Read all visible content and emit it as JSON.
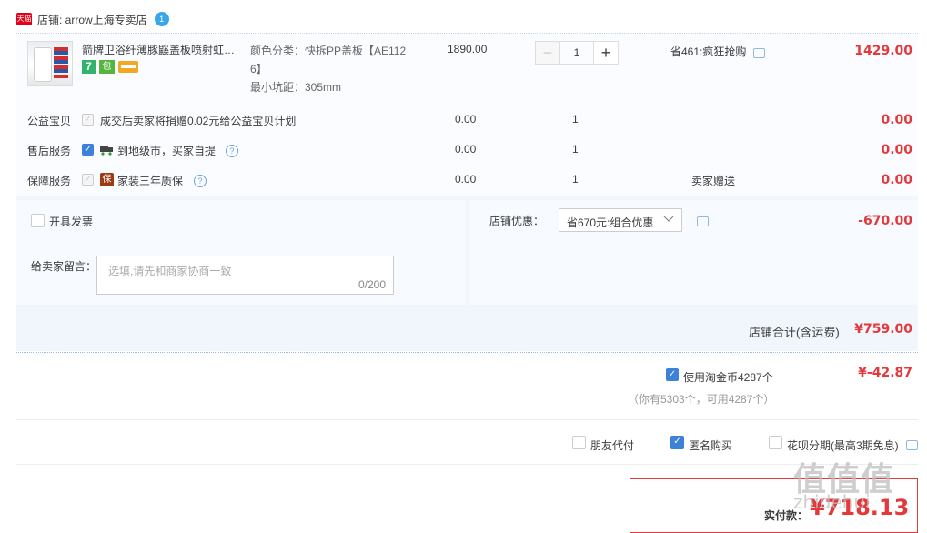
{
  "shop": {
    "label": "店铺: arrow上海专卖店",
    "badge": "天猫",
    "chat_badge": "1"
  },
  "item": {
    "title": "箭牌卫浴纤薄豚鼷盖板喷射虹吸马桶",
    "badge_seven": "7",
    "badge_green": "包",
    "sku_line1": "颜色分类：快拆PP盖板【AE112",
    "sku_line2": "6】",
    "sku_line3": "最小坑距：305mm",
    "price": "1890.00",
    "qty": "1",
    "promo": "省461:疯狂抢购",
    "amount": "1429.00"
  },
  "services": [
    {
      "label": "公益宝贝",
      "checked": false,
      "text": "成交后卖家将捐赠0.02元给公益宝贝计划",
      "price": "0.00",
      "qty": "1",
      "note": "",
      "amount": "0.00"
    },
    {
      "label": "售后服务",
      "checked": true,
      "text": "到地级市，买家自提",
      "price": "0.00",
      "qty": "1",
      "note": "",
      "amount": "0.00"
    },
    {
      "label": "保障服务",
      "checked": false,
      "text": "家装三年质保",
      "price": "0.00",
      "qty": "1",
      "note": "卖家赠送",
      "amount": "0.00"
    }
  ],
  "invoice_label": "开具发票",
  "remark": {
    "label": "给卖家留言：",
    "placeholder": "选填,请先和商家协商一致",
    "counter": "0/200"
  },
  "shop_discount": {
    "label": "店铺优惠：",
    "selected": "省670元:组合优惠",
    "amount": "-670.00"
  },
  "subtotal": {
    "label": "店铺合计(含运费)",
    "value": "¥759.00"
  },
  "coins": {
    "label": "使用淘金币4287个",
    "sub": "（你有5303个，可用4287个）",
    "amount": "¥-42.87"
  },
  "options": {
    "friend_pay": "朋友代付",
    "anonymous": "匿名购买",
    "installment": "花呗分期(最高3期免息)"
  },
  "pay": {
    "label": "实付款：",
    "value": "¥718.13"
  },
  "watermark": {
    "logo": "值值值",
    "text": "zhidehui"
  },
  "colors": {
    "accent": "#e4393c",
    "blue": "#3d82d8",
    "panel": "#f1f6fd"
  }
}
